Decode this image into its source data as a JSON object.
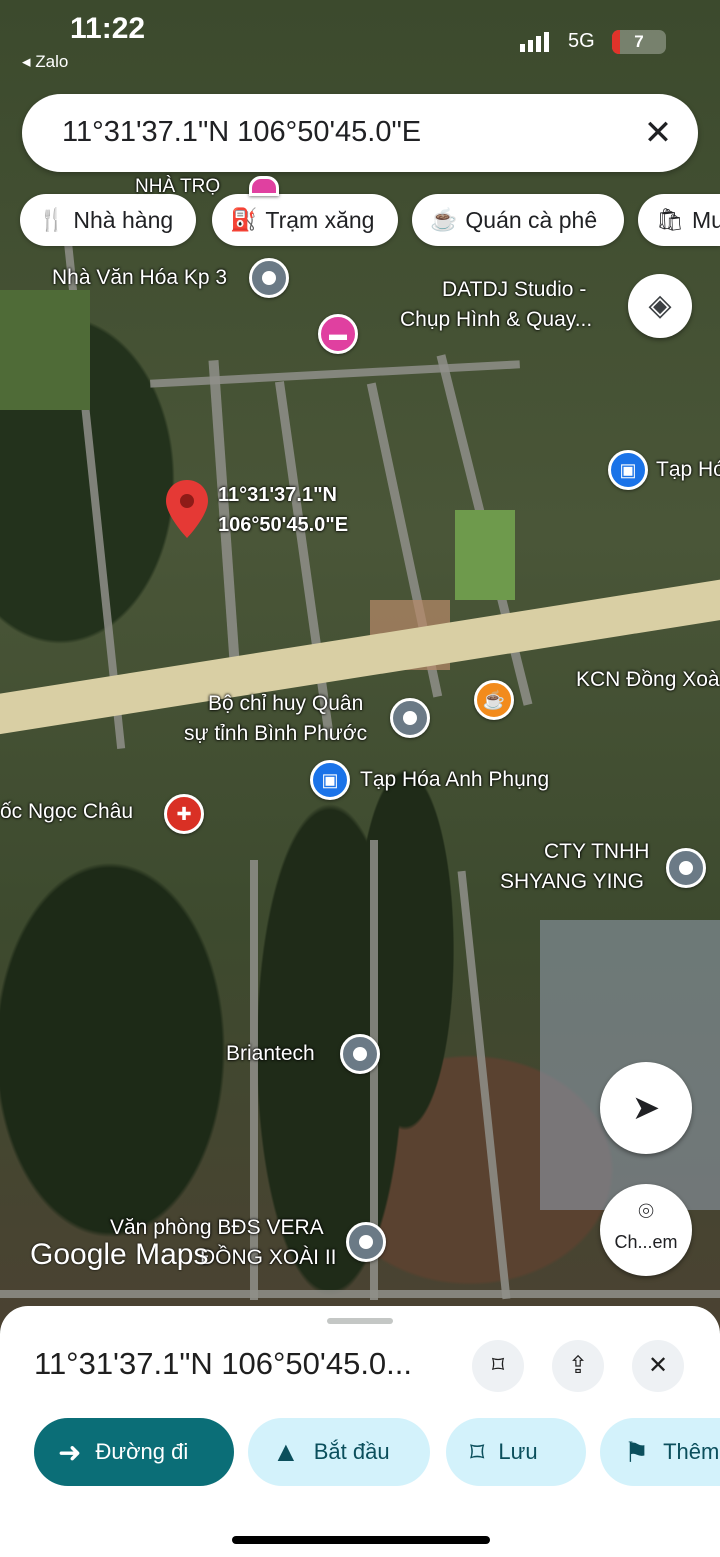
{
  "status_bar": {
    "time": "11:22",
    "back_app": "◂ Zalo",
    "network": "5G",
    "battery": "7"
  },
  "search": {
    "query": "11°31'37.1\"N 106°50'45.0\"E",
    "close_icon": "✕"
  },
  "chips": [
    {
      "icon": "restaurant-icon",
      "glyph": "🍴",
      "label": "Nhà hàng"
    },
    {
      "icon": "gas-station-icon",
      "glyph": "⛽",
      "label": "Trạm xăng"
    },
    {
      "icon": "coffee-icon",
      "glyph": "☕",
      "label": "Quán cà phê"
    },
    {
      "icon": "shopping-bag-icon",
      "glyph": "🛍",
      "label": "Mu"
    }
  ],
  "map": {
    "pin_label_line1": "11°31'37.1\"N",
    "pin_label_line2": "106°50'45.0\"E",
    "places": {
      "nha_tro": "NHÀ TRỌ",
      "nha_van_hoa": "Nhà Văn Hóa Kp 3",
      "datdj_1": "DATDJ Studio -",
      "datdj_2": "Chụp Hình & Quay...",
      "tap_ho": "Tạp Hó",
      "kcn": "KCN Đồng Xoà",
      "bo_chi_huy_1": "Bộ chỉ huy Quân",
      "bo_chi_huy_2": "sự tỉnh Bình Phước",
      "tap_hoa_anh_phung": "Tạp Hóa Anh Phụng",
      "oc_ngoc_chau": "ốc Ngọc Châu",
      "cty_1": "CTY TNHH",
      "cty_2": "SHYANG YING",
      "briantech": "Briantech",
      "van_phong": "Văn phòng BĐS VERA",
      "dong_xoai": "ĐỒNG XOÀI II"
    },
    "logo": "Google Maps",
    "lens_label": "Ch...em"
  },
  "sheet": {
    "title": "11°31'37.1\"N 106°50'45.0...",
    "actions": [
      {
        "icon": "directions-icon",
        "glyph": "➜",
        "label": "Đường đi"
      },
      {
        "icon": "navigation-start-icon",
        "glyph": "▲",
        "label": "Bắt đầu"
      },
      {
        "icon": "bookmark-icon",
        "glyph": "⌑",
        "label": "Lưu"
      },
      {
        "icon": "flag-icon",
        "glyph": "⚑",
        "label": "Thêm"
      }
    ]
  },
  "colors": {
    "primary": "#0b6e77",
    "secondary": "#d3f2fb",
    "pin": "#e53935",
    "poi_grey": "#6b7a86",
    "poi_blue": "#1a73e8",
    "poi_pink": "#e040a0",
    "poi_orange": "#f28b1c",
    "poi_red": "#d93025"
  }
}
